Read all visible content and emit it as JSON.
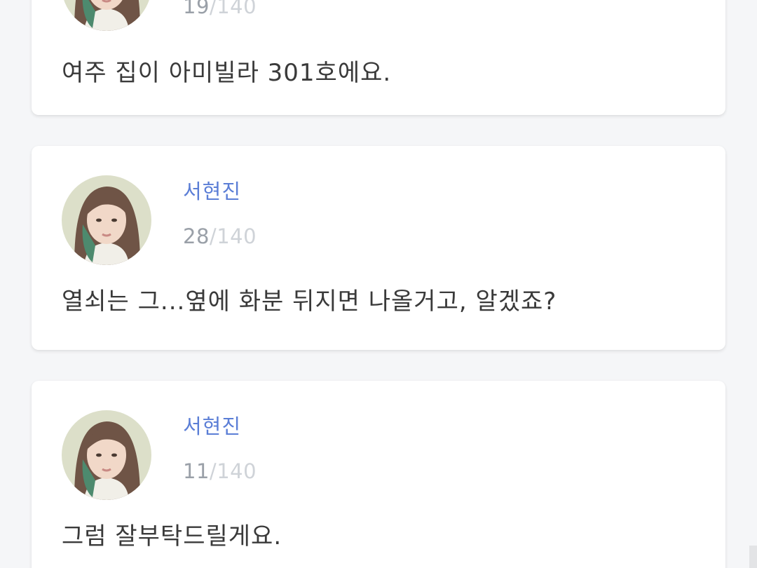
{
  "colors": {
    "background": "#f5f6f8",
    "card": "#ffffff",
    "author_name": "#5b7ed6",
    "count": "#9aa0a8",
    "limit": "#cfd3d8",
    "message": "#3a3a3a"
  },
  "posts": [
    {
      "author": "",
      "count": "19",
      "separator": "/",
      "limit": "140",
      "avatar_icon": "profile-avatar",
      "message": "여주 집이 아미빌라 301호에요."
    },
    {
      "author": "서현진",
      "count": "28",
      "separator": "/",
      "limit": "140",
      "avatar_icon": "profile-avatar",
      "message": "열쇠는 그...옆에 화분 뒤지면 나올거고, 알겠죠?"
    },
    {
      "author": "서현진",
      "count": "11",
      "separator": "/",
      "limit": "140",
      "avatar_icon": "profile-avatar",
      "message": "그럼 잘부탁드릴게요."
    }
  ]
}
